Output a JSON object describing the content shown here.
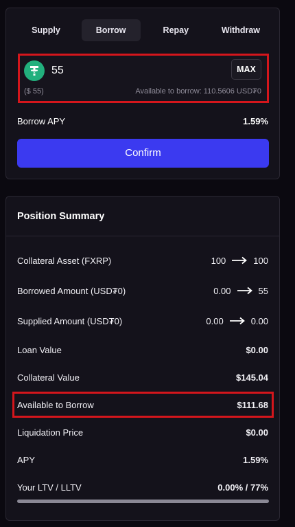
{
  "tabs": [
    {
      "label": "Supply",
      "active": false
    },
    {
      "label": "Borrow",
      "active": true
    },
    {
      "label": "Repay",
      "active": false
    },
    {
      "label": "Withdraw",
      "active": false
    }
  ],
  "amount": {
    "value": "55",
    "usd_value": "($ 55)",
    "max_label": "MAX",
    "available_text": "Available to borrow: 110.5606 USD₮0",
    "token_icon": "tether-usdt0-icon"
  },
  "borrow_apy": {
    "label": "Borrow APY",
    "value": "1.59%"
  },
  "confirm_label": "Confirm",
  "summary": {
    "title": "Position Summary",
    "rows": [
      {
        "label": "Collateral Asset (FXRP)",
        "from": "100",
        "to": "100"
      },
      {
        "label": "Borrowed Amount (USD₮0)",
        "from": "0.00",
        "to": "55"
      },
      {
        "label": "Supplied Amount (USD₮0)",
        "from": "0.00",
        "to": "0.00"
      },
      {
        "label": "Loan Value",
        "value": "$0.00"
      },
      {
        "label": "Collateral Value",
        "value": "$145.04"
      },
      {
        "label": "Available to Borrow",
        "value": "$111.68"
      },
      {
        "label": "Liquidation Price",
        "value": "$0.00"
      },
      {
        "label": "APY",
        "value": "1.59%"
      },
      {
        "label": "Your LTV / LLTV",
        "value": "0.00% / 77%"
      }
    ],
    "ltv_progress": 0
  },
  "colors": {
    "accent": "#3b3af0",
    "highlight": "#d4161c",
    "token": "#22b07d"
  }
}
